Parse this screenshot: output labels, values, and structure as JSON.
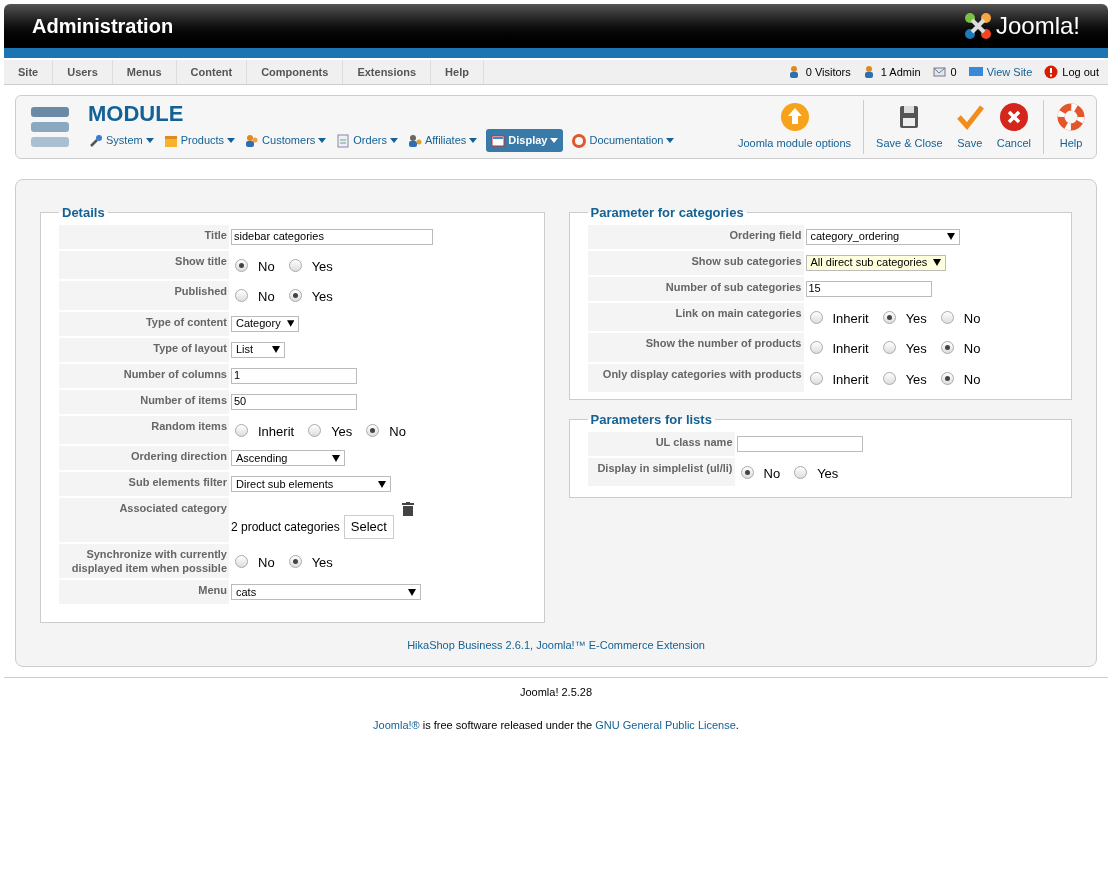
{
  "header": {
    "title": "Administration",
    "logo": "Joomla!"
  },
  "menu": {
    "items": [
      "Site",
      "Users",
      "Menus",
      "Content",
      "Components",
      "Extensions",
      "Help"
    ],
    "status": [
      {
        "kind": "visitors",
        "text": "0 Visitors"
      },
      {
        "kind": "admin",
        "text": "1 Admin"
      },
      {
        "kind": "messages",
        "text": "0"
      },
      {
        "kind": "view",
        "text": "View Site"
      },
      {
        "kind": "logout",
        "text": "Log out"
      }
    ]
  },
  "toolbar": {
    "title": "MODULE",
    "submenu": [
      {
        "label": "System",
        "selected": false
      },
      {
        "label": "Products",
        "selected": false
      },
      {
        "label": "Customers",
        "selected": false
      },
      {
        "label": "Orders",
        "selected": false
      },
      {
        "label": "Affiliates",
        "selected": false
      },
      {
        "label": "Display",
        "selected": true
      },
      {
        "label": "Documentation",
        "selected": false
      }
    ],
    "actions": [
      {
        "kind": "options",
        "label": "Joomla module options"
      },
      {
        "kind": "save-close",
        "label": "Save & Close"
      },
      {
        "kind": "save",
        "label": "Save"
      },
      {
        "kind": "cancel",
        "label": "Cancel"
      },
      {
        "kind": "help",
        "label": "Help"
      }
    ]
  },
  "details": {
    "legend": "Details",
    "rows": [
      {
        "label": "Title",
        "kind": "text",
        "value": "sidebar categories"
      },
      {
        "label": "Show title",
        "kind": "radio",
        "options": [
          {
            "label": "No",
            "selected": true
          },
          {
            "label": "Yes",
            "selected": false
          }
        ]
      },
      {
        "label": "Published",
        "kind": "radio",
        "options": [
          {
            "label": "No",
            "selected": false
          },
          {
            "label": "Yes",
            "selected": true
          }
        ]
      },
      {
        "label": "Type of content",
        "kind": "select",
        "value": "Category"
      },
      {
        "label": "Type of layout",
        "kind": "select",
        "value": "List"
      },
      {
        "label": "Number of columns",
        "kind": "text",
        "value": "1"
      },
      {
        "label": "Number of items",
        "kind": "text",
        "value": "50"
      },
      {
        "label": "Random items",
        "kind": "radio",
        "options": [
          {
            "label": "Inherit",
            "selected": false
          },
          {
            "label": "Yes",
            "selected": false
          },
          {
            "label": "No",
            "selected": true
          }
        ]
      },
      {
        "label": "Ordering direction",
        "kind": "select",
        "value": "Ascending"
      },
      {
        "label": "Sub elements filter",
        "kind": "select",
        "value": "Direct sub elements"
      },
      {
        "label": "Associated category",
        "kind": "category",
        "value": "2 product categories",
        "button": "Select"
      },
      {
        "label": "Synchronize with currently displayed item when possible",
        "kind": "radio",
        "options": [
          {
            "label": "No",
            "selected": false
          },
          {
            "label": "Yes",
            "selected": true
          }
        ]
      },
      {
        "label": "Menu",
        "kind": "select",
        "value": "cats"
      }
    ]
  },
  "categories": {
    "legend": "Parameter for categories",
    "rows": [
      {
        "label": "Ordering field",
        "kind": "select",
        "value": "category_ordering"
      },
      {
        "label": "Show sub categories",
        "kind": "select",
        "value": "All direct sub categories",
        "highlighted": true
      },
      {
        "label": "Number of sub categories",
        "kind": "text",
        "value": "15"
      },
      {
        "label": "Link on main categories",
        "kind": "radio",
        "options": [
          {
            "label": "Inherit",
            "selected": false
          },
          {
            "label": "Yes",
            "selected": true
          },
          {
            "label": "No",
            "selected": false
          }
        ]
      },
      {
        "label": "Show the number of products",
        "kind": "radio",
        "options": [
          {
            "label": "Inherit",
            "selected": false
          },
          {
            "label": "Yes",
            "selected": false
          },
          {
            "label": "No",
            "selected": true
          }
        ]
      },
      {
        "label": "Only display categories with products",
        "kind": "radio",
        "options": [
          {
            "label": "Inherit",
            "selected": false
          },
          {
            "label": "Yes",
            "selected": false
          },
          {
            "label": "No",
            "selected": true
          }
        ]
      }
    ]
  },
  "lists": {
    "legend": "Parameters for lists",
    "rows": [
      {
        "label": "UL class name",
        "kind": "text",
        "value": ""
      },
      {
        "label": "Display in simplelist (ul/li)",
        "kind": "radio",
        "options": [
          {
            "label": "No",
            "selected": true
          },
          {
            "label": "Yes",
            "selected": false
          }
        ]
      }
    ]
  },
  "credit": "HikaShop Business 2.6.1, Joomla!™ E-Commerce Extension",
  "footer": {
    "version": "Joomla! 2.5.28",
    "license": {
      "link": "Joomla!®",
      "text": " is free software released under the ",
      "link2": "GNU General Public License",
      "end": "."
    }
  }
}
